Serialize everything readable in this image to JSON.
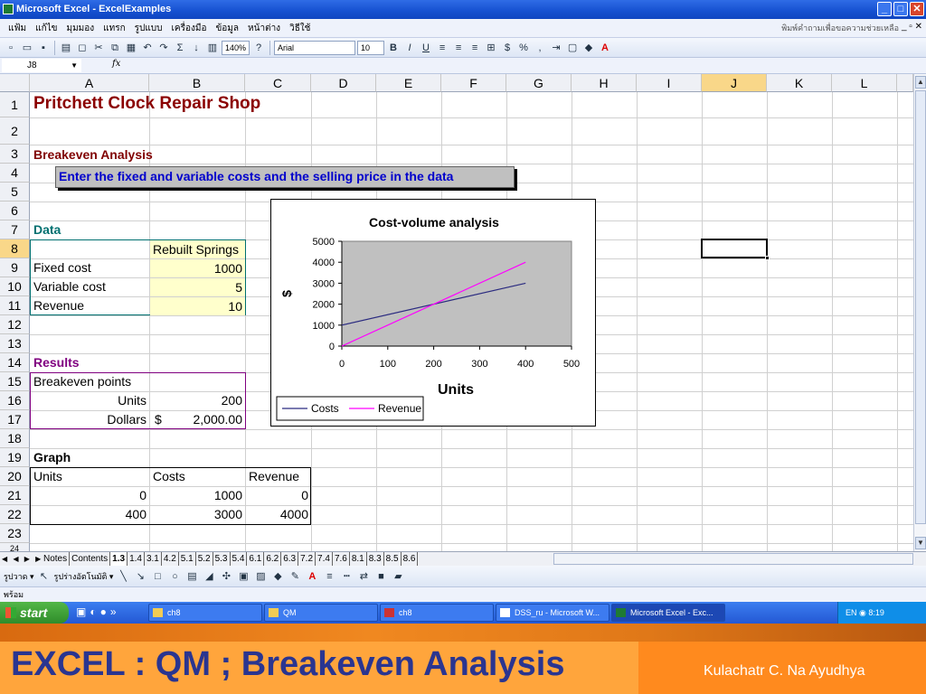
{
  "window": {
    "title": "Microsoft Excel - ExcelExamples",
    "btn_min": "_",
    "btn_max": "□",
    "btn_close": "✕"
  },
  "menu": {
    "items": [
      "แฟ้ม",
      "แก้ไข",
      "มุมมอง",
      "แทรก",
      "รูปแบบ",
      "เครื่องมือ",
      "ข้อมูล",
      "หน้าต่าง",
      "วิธีใช้"
    ],
    "help_placeholder": "พิมพ์คำถามเพื่อขอความช่วยเหลือ",
    "controls": "_ ▫ ✕"
  },
  "toolbar": {
    "zoom": "140%",
    "font": "Arial",
    "font_size": "10",
    "bold": "B",
    "italic": "I",
    "underline": "U",
    "percent": "%",
    "comma": ","
  },
  "formula": {
    "cell_ref": "J8",
    "fx": "fx",
    "dropdown": "▼"
  },
  "columns": [
    "A",
    "B",
    "C",
    "D",
    "E",
    "F",
    "G",
    "H",
    "I",
    "J",
    "K",
    "L"
  ],
  "rows": [
    "1",
    "2",
    "3",
    "4",
    "5",
    "6",
    "7",
    "8",
    "9",
    "10",
    "11",
    "12",
    "13",
    "14",
    "15",
    "16",
    "17",
    "18",
    "19",
    "20",
    "21",
    "22",
    "23",
    "24"
  ],
  "sheet": {
    "title": "Pritchett Clock Repair Shop",
    "subtitle": "Breakeven Analysis",
    "instruction": "Enter the fixed and variable costs and the selling price in the data",
    "data_label": "Data",
    "data_header": "Rebuilt Springs",
    "data_rows": [
      {
        "label": "Fixed cost",
        "value": "1000"
      },
      {
        "label": "Variable cost",
        "value": "5"
      },
      {
        "label": "Revenue",
        "value": "10"
      }
    ],
    "results_label": "Results",
    "breakeven_label": "Breakeven points",
    "units_label": "Units",
    "units_value": "200",
    "dollars_label": "Dollars",
    "dollars_sign": "$",
    "dollars_value": "2,000.00",
    "graph_label": "Graph",
    "graph_headers": [
      "Units",
      "Costs",
      "Revenue"
    ],
    "graph_rows": [
      [
        "0",
        "1000",
        "0"
      ],
      [
        "400",
        "3000",
        "4000"
      ]
    ]
  },
  "chart_data": {
    "type": "line",
    "title": "Cost-volume analysis",
    "xlabel": "Units",
    "ylabel": "$",
    "x": [
      0,
      400
    ],
    "series": [
      {
        "name": "Costs",
        "values": [
          1000,
          3000
        ],
        "color": "#2b2b80"
      },
      {
        "name": "Revenue",
        "values": [
          0,
          4000
        ],
        "color": "#ff00ff"
      }
    ],
    "xlim": [
      0,
      500
    ],
    "ylim": [
      0,
      5000
    ],
    "xticks": [
      "0",
      "100",
      "200",
      "300",
      "400",
      "500"
    ],
    "yticks": [
      "0",
      "1000",
      "2000",
      "3000",
      "4000",
      "5000"
    ],
    "legend": "bottom-left",
    "plot_bg": "#c0c0c0"
  },
  "tabs": {
    "nav": "◀ ◀ ▶ ▶",
    "items": [
      "Notes",
      "Contents",
      "1.3",
      "1.4",
      "3.1",
      "4.2",
      "5.1",
      "5.2",
      "5.3",
      "5.4",
      "6.1",
      "6.2",
      "6.3",
      "7.2",
      "7.4",
      "7.6",
      "8.1",
      "8.3",
      "8.5",
      "8.6"
    ],
    "active": "1.3"
  },
  "drawbar": {
    "draw_label": "รูปวาด ▾",
    "autoshapes_label": "รูปร่างอัตโนมัติ ▾"
  },
  "status": {
    "text": "พร้อม"
  },
  "taskbar": {
    "start": "start",
    "items": [
      "ch8",
      "QM",
      "ch8",
      "DSS_ru - Microsoft W...",
      "Microsoft Excel - Exc..."
    ],
    "lang": "EN",
    "clock": "8:19"
  },
  "slide": {
    "title": "EXCEL  : QM ; Breakeven Analysis",
    "author": "Kulachatr C. Na Ayudhya"
  },
  "colors": {
    "accent": "#2a3590",
    "orange": "#ff8a1e",
    "select": "#f9d789"
  }
}
